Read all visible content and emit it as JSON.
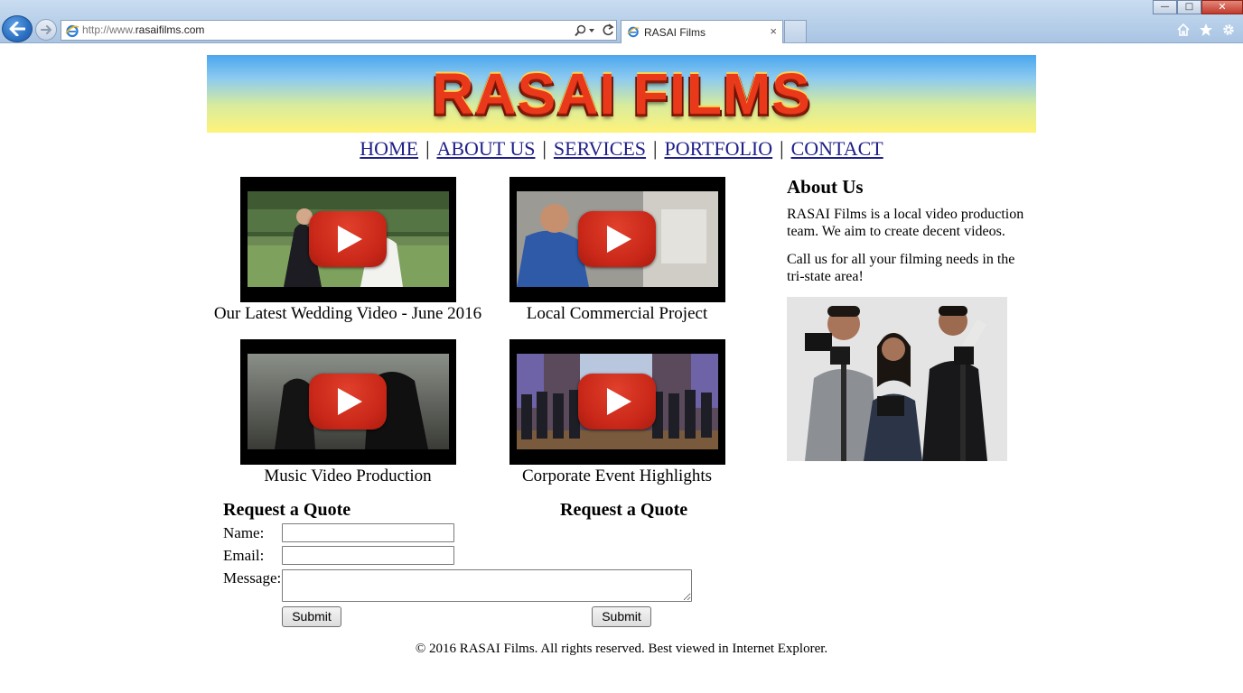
{
  "browser": {
    "url_prefix": "http://www.",
    "url_domain": "rasaifilms.com",
    "tab_title": "RASAI Films",
    "tab_close": "×",
    "window_buttons": {
      "minimize": "—",
      "maximize": "□",
      "close": "✕"
    },
    "icons": [
      "back-icon",
      "forward-icon",
      "ie-icon",
      "search-icon",
      "refresh-icon",
      "home-icon",
      "star-icon",
      "gear-icon"
    ]
  },
  "site": {
    "banner_title": "RASAI FILMS",
    "nav": [
      {
        "label": "HOME"
      },
      {
        "label": "ABOUT US"
      },
      {
        "label": "SERVICES"
      },
      {
        "label": "PORTFOLIO"
      },
      {
        "label": "CONTACT"
      }
    ],
    "nav_separator": "|",
    "videos": [
      {
        "caption": "Our Latest Wedding Video - June 2016"
      },
      {
        "caption": "Local Commercial Project"
      },
      {
        "caption": "Music Video Production"
      },
      {
        "caption": "Corporate Event Highlights"
      }
    ],
    "about": {
      "heading": "About Us",
      "p1": "RASAI Films is a local video production team. We aim to create decent videos.",
      "p2": "Call us for all your filming needs in the tri-state area!"
    },
    "quote_form": {
      "heading_left": "Request a Quote",
      "heading_right": "Request a Quote",
      "name_label": "Name:",
      "email_label": "Email:",
      "message_label": "Message:",
      "name_value": "",
      "email_value": "",
      "message_value": "",
      "submit_left": "Submit",
      "submit_right": "Submit"
    },
    "footer": "© 2016 RASAI Films. All rights reserved. Best viewed in Internet Explorer."
  },
  "colors": {
    "banner_top": "#4aa6ee",
    "banner_bottom": "#fff27a",
    "banner_text": "#e9391a",
    "play_button": "#c92718",
    "link": "#1f1f8a"
  }
}
